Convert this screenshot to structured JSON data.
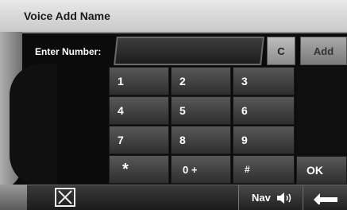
{
  "title": "Voice Add Name",
  "entry": {
    "label": "Enter Number:",
    "value": ""
  },
  "buttons": {
    "clear": "C",
    "add": "Add",
    "ok": "OK",
    "nav": "Nav"
  },
  "keypad": {
    "k1": "1",
    "k2": "2",
    "k3": "3",
    "k4": "4",
    "k5": "5",
    "k6": "6",
    "k7": "7",
    "k8": "8",
    "k9": "9",
    "star": "*",
    "zero": "0 +",
    "hash": "#"
  },
  "icons": {
    "close": "close-box-icon",
    "speaker": "speaker-icon",
    "back": "back-arrow-icon"
  },
  "colors": {
    "background": "#0b0b0b",
    "title_bar": "#d9d9d9",
    "key": "#454545",
    "text": "#ffffff"
  }
}
